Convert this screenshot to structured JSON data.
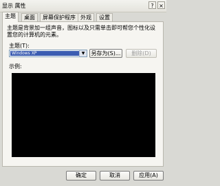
{
  "window": {
    "title": "显示 属性",
    "help_label": "?",
    "close_label": "×"
  },
  "tabs": [
    "主题",
    "桌面",
    "屏幕保护程序",
    "外观",
    "设置"
  ],
  "themes": {
    "description": "主题是背景加一组声音，图标以及只需单击即可帮您个性化设置您的计算机的元素。",
    "theme_label": "主题(T):",
    "theme_value": "Windows XP",
    "combo_arrow": "▼",
    "save_as_label": "另存为(S)...",
    "delete_label": "删除(D)",
    "preview_label": "示例:"
  },
  "footer": {
    "ok_label": "确定",
    "cancel_label": "取消",
    "apply_label": "应用(A)"
  }
}
